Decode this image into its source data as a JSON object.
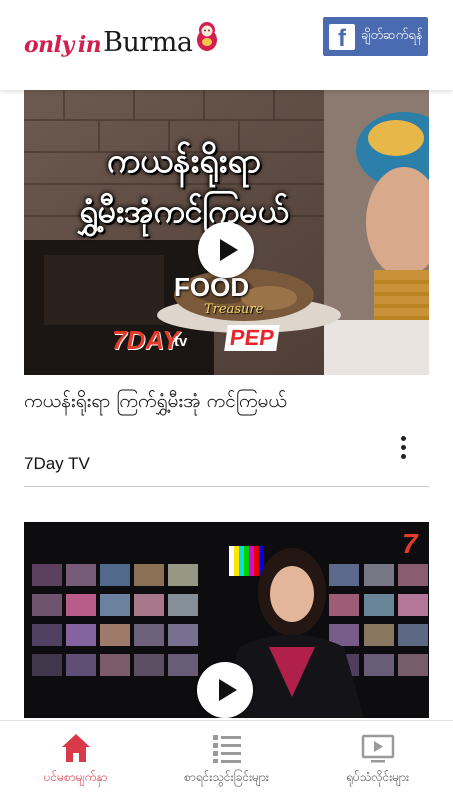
{
  "header": {
    "logo": {
      "part1": "only",
      "part2": "in",
      "part3": "Burma"
    },
    "facebook_button": {
      "icon": "facebook-icon",
      "label": "ချိတ်ဆက်ရန်"
    }
  },
  "feed": [
    {
      "thumbnail": {
        "overlay_line1": "ကယန်းရိုးရာ",
        "overlay_line2": "ရွှံ့မီးအုံကင်ကြမယ်",
        "brand_food": "FOOD",
        "brand_treasure": "Treasure",
        "brand_7day": "7DAY",
        "brand_tv": "tv",
        "brand_pep": "PEP"
      },
      "title": "ကယန်းရိုးရာ ကြက်ရွှံ့မီးအုံ ကင်ကြမယ်",
      "source": "7Day TV"
    },
    {
      "thumbnail": {
        "corner_text": "7"
      }
    }
  ],
  "bottom_nav": [
    {
      "label": "ပင်မစာမျက်နှာ",
      "icon": "home-icon",
      "active": true
    },
    {
      "label": "စာရင်းသွင်းခြင်းများ",
      "icon": "list-icon",
      "active": false
    },
    {
      "label": "ရုပ်သံလိုင်းများ",
      "icon": "tv-play-icon",
      "active": false
    }
  ],
  "colors": {
    "accent": "#d83a4a",
    "facebook": "#4a6bb0",
    "inactive_icon": "#9a9a9a"
  }
}
